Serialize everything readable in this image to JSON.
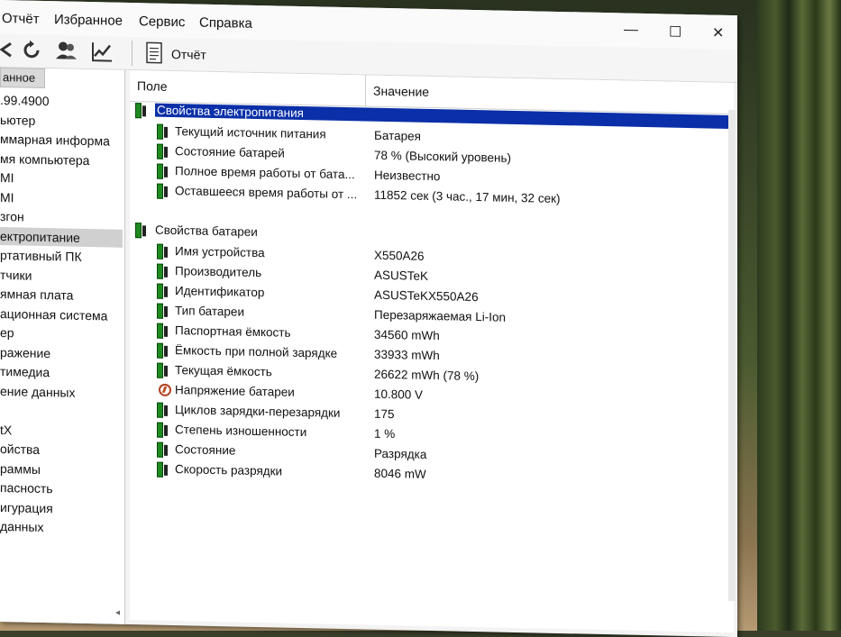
{
  "menu": {
    "items": [
      "Отчёт",
      "Избранное",
      "Сервис",
      "Справка"
    ],
    "minimize": "—",
    "maximize": "☐",
    "close": "✕"
  },
  "toolbar": {
    "report_label": "Отчёт",
    "icons": [
      "back-icon",
      "refresh-icon",
      "user-icon",
      "chart-icon",
      "report-icon"
    ]
  },
  "tree": {
    "header": "анное",
    "items": [
      ".99.4900",
      "ьютер",
      "ммарная информа",
      "мя компьютера",
      "MI",
      "MI",
      "згон",
      "ектропитание",
      "ртативный ПК",
      "тчики",
      "ямная плата",
      "ационная система",
      "ер",
      "ражение",
      "тимедиа",
      "ение данных",
      "",
      "tX",
      "ойства",
      "раммы",
      "пасность",
      "игурация",
      "данных"
    ],
    "selected_index": 7
  },
  "columns": {
    "field": "Поле",
    "value": "Значение"
  },
  "groups": [
    {
      "title": "Свойства электропитания",
      "rows": [
        {
          "field": "Текущий источник питания",
          "value": "Батарея",
          "icon": "battery-icon"
        },
        {
          "field": "Состояние батарей",
          "value": "78 % (Высокий уровень)",
          "icon": "battery-icon"
        },
        {
          "field": "Полное время работы от бата...",
          "value": "Неизвестно",
          "icon": "battery-icon"
        },
        {
          "field": "Оставшееся время работы от ...",
          "value": "11852 сек (3 час., 17 мин, 32 сек)",
          "icon": "battery-icon"
        }
      ]
    },
    {
      "title": "Свойства батареи",
      "rows": [
        {
          "field": "Имя устройства",
          "value": "X550A26",
          "icon": "battery-icon"
        },
        {
          "field": "Производитель",
          "value": "ASUSTeK",
          "icon": "battery-icon"
        },
        {
          "field": "Идентификатор",
          "value": "ASUSTeKX550A26",
          "icon": "battery-icon"
        },
        {
          "field": "Тип батареи",
          "value": "Перезаряжаемая Li-Ion",
          "icon": "battery-icon"
        },
        {
          "field": "Паспортная ёмкость",
          "value": "34560 mWh",
          "icon": "battery-icon"
        },
        {
          "field": "Ёмкость при полной зарядке",
          "value": "33933 mWh",
          "icon": "battery-icon"
        },
        {
          "field": "Текущая ёмкость",
          "value": "26622 mWh  (78 %)",
          "icon": "battery-icon"
        },
        {
          "field": "Напряжение батареи",
          "value": "10.800 V",
          "icon": "voltage-icon"
        },
        {
          "field": "Циклов зарядки-перезарядки",
          "value": "175",
          "icon": "battery-icon"
        },
        {
          "field": "Степень изношенности",
          "value": "1 %",
          "icon": "battery-icon"
        },
        {
          "field": "Состояние",
          "value": "Разрядка",
          "icon": "battery-icon"
        },
        {
          "field": "Скорость разрядки",
          "value": "8046 mW",
          "icon": "battery-icon"
        }
      ]
    }
  ]
}
